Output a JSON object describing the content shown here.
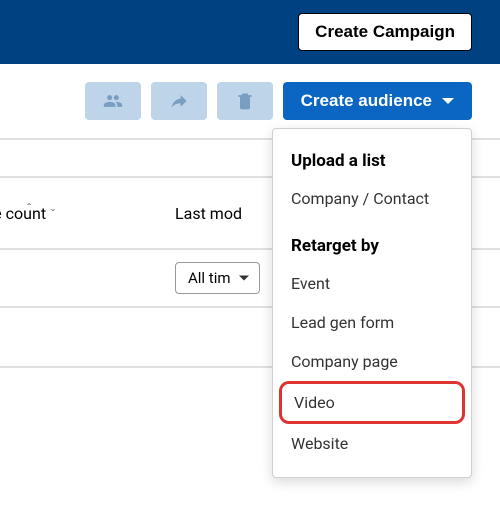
{
  "header": {
    "create_campaign_label": "Create Campaign"
  },
  "toolbar": {
    "icons": [
      "people-icon",
      "share-icon",
      "trash-icon"
    ],
    "create_audience_label": "Create audience"
  },
  "table": {
    "columns": {
      "count_label": "nce count",
      "modified_label": "Last mod"
    },
    "filter": {
      "selected": "All tim"
    }
  },
  "dropdown": {
    "upload": {
      "title": "Upload a list",
      "items": [
        "Company / Contact"
      ]
    },
    "retarget": {
      "title": "Retarget by",
      "items": [
        "Event",
        "Lead gen form",
        "Company page",
        "Video",
        "Website"
      ],
      "highlighted": "Video"
    }
  }
}
